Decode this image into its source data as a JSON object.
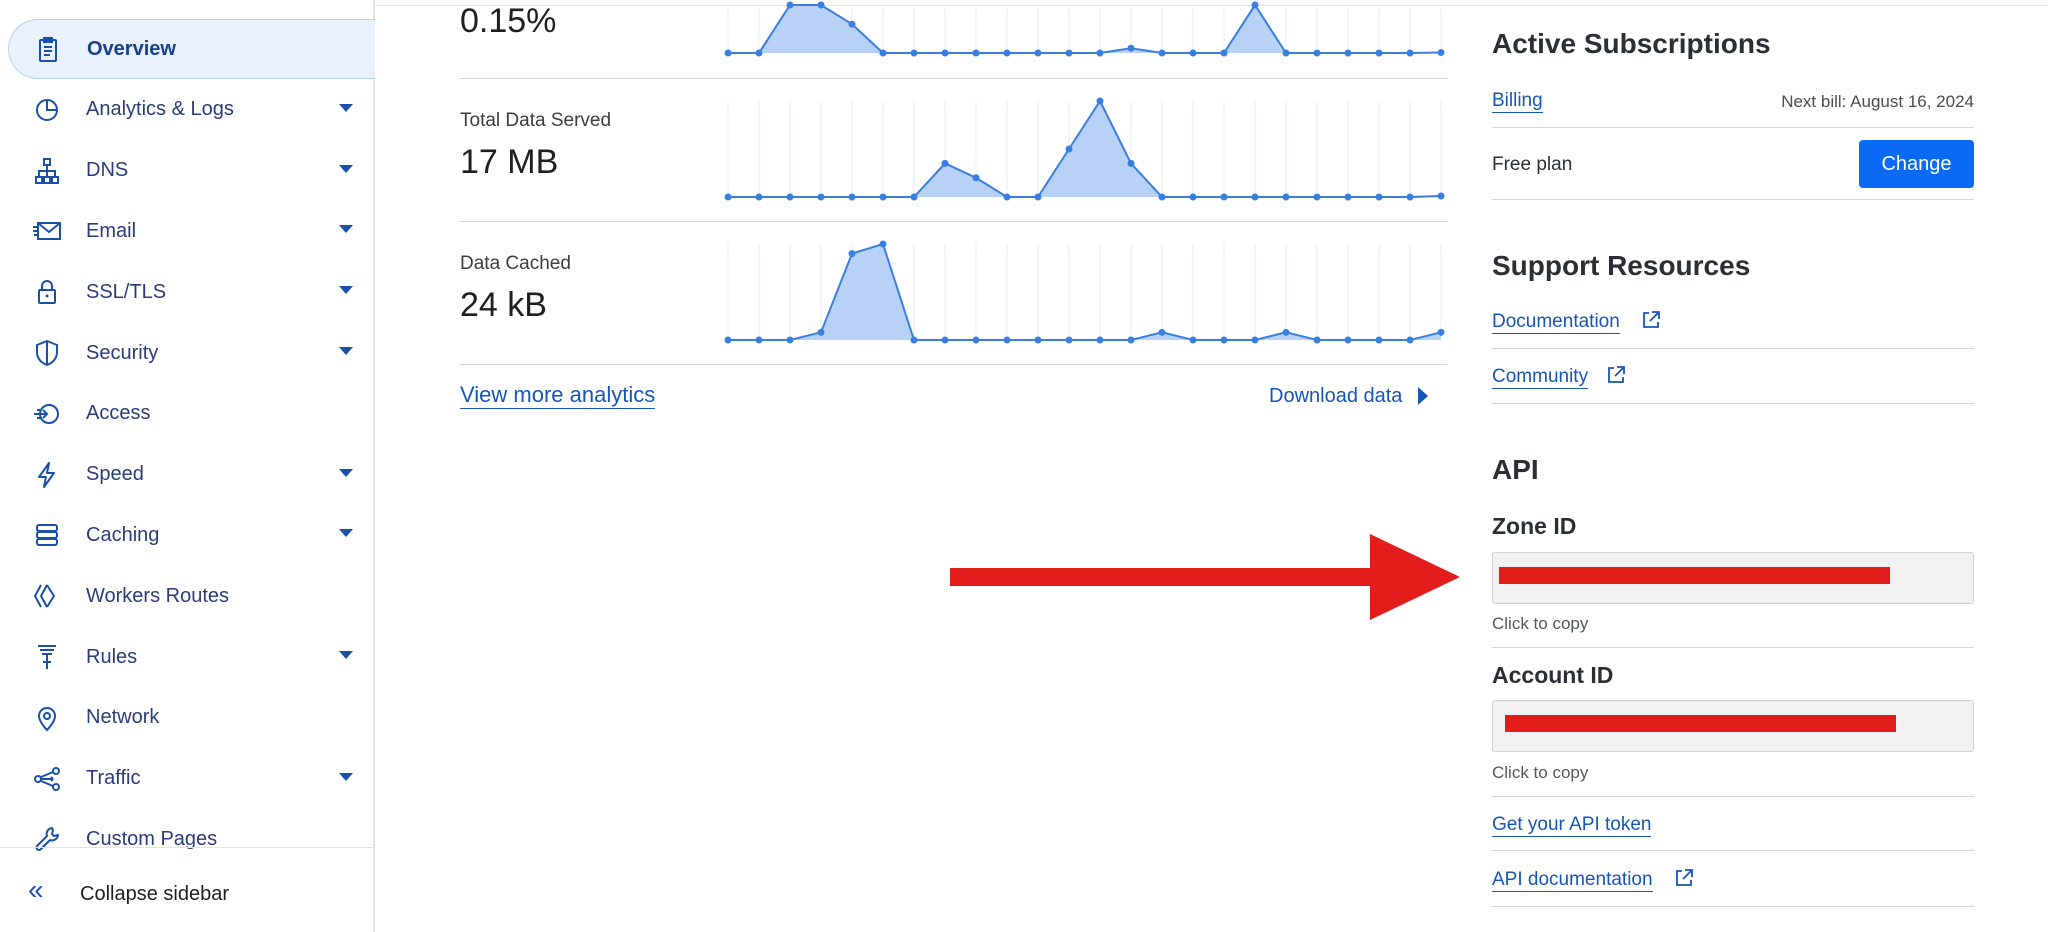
{
  "sidebar": {
    "items": [
      {
        "label": "Overview",
        "icon": "clipboard-icon",
        "active": true,
        "has_caret": false
      },
      {
        "label": "Analytics & Logs",
        "icon": "pie-chart-icon",
        "has_caret": true
      },
      {
        "label": "DNS",
        "icon": "network-tree-icon",
        "has_caret": true
      },
      {
        "label": "Email",
        "icon": "envelope-icon",
        "has_caret": true
      },
      {
        "label": "SSL/TLS",
        "icon": "lock-icon",
        "has_caret": true
      },
      {
        "label": "Security",
        "icon": "shield-icon",
        "has_caret": true
      },
      {
        "label": "Access",
        "icon": "access-icon",
        "has_caret": false
      },
      {
        "label": "Speed",
        "icon": "lightning-icon",
        "has_caret": true
      },
      {
        "label": "Caching",
        "icon": "server-stack-icon",
        "has_caret": true
      },
      {
        "label": "Workers Routes",
        "icon": "workers-icon",
        "has_caret": false
      },
      {
        "label": "Rules",
        "icon": "funnel-icon",
        "has_caret": true
      },
      {
        "label": "Network",
        "icon": "location-pin-icon",
        "has_caret": false
      },
      {
        "label": "Traffic",
        "icon": "traffic-icon",
        "has_caret": true
      },
      {
        "label": "Custom Pages",
        "icon": "wrench-icon",
        "has_caret": false
      }
    ],
    "collapse_label": "Collapse sidebar"
  },
  "metrics": [
    {
      "label": "",
      "value": "0.15%"
    },
    {
      "label": "Total Data Served",
      "value": "17 MB"
    },
    {
      "label": "Data Cached",
      "value": "24 kB"
    }
  ],
  "sparklines": [
    [
      0,
      0,
      5,
      5,
      3,
      0,
      0,
      0,
      0,
      0,
      0,
      0,
      0,
      0.5,
      0,
      0,
      0,
      5,
      0,
      0,
      0,
      0,
      0,
      0.05
    ],
    [
      0,
      0,
      0,
      0,
      0,
      0,
      0,
      0.35,
      0.2,
      0,
      0,
      0.5,
      1,
      0.35,
      0,
      0,
      0,
      0,
      0,
      0,
      0,
      0,
      0,
      0.01
    ],
    [
      0,
      0,
      0,
      0.08,
      0.9,
      1,
      0,
      0,
      0,
      0,
      0,
      0,
      0,
      0,
      0.08,
      0,
      0,
      0,
      0.08,
      0,
      0,
      0,
      0,
      0.08
    ]
  ],
  "colors": {
    "accent": "#0b6af5",
    "link": "#1656b9",
    "spark_fill": "#b8d1f7",
    "spark_line": "#3a7fe0",
    "arrow": "#e31c1c"
  },
  "analytics": {
    "view_more": "View more analytics",
    "download": "Download data"
  },
  "subscriptions": {
    "title": "Active Subscriptions",
    "billing_link": "Billing",
    "next_bill": "Next bill: August 16, 2024",
    "plan": "Free plan",
    "change_label": "Change"
  },
  "support": {
    "title": "Support Resources",
    "documentation": "Documentation",
    "community": "Community"
  },
  "api": {
    "title": "API",
    "zone_id_label": "Zone ID",
    "account_id_label": "Account ID",
    "copy_hint": "Click to copy",
    "token_link": "Get your API token",
    "docs_link": "API documentation"
  }
}
